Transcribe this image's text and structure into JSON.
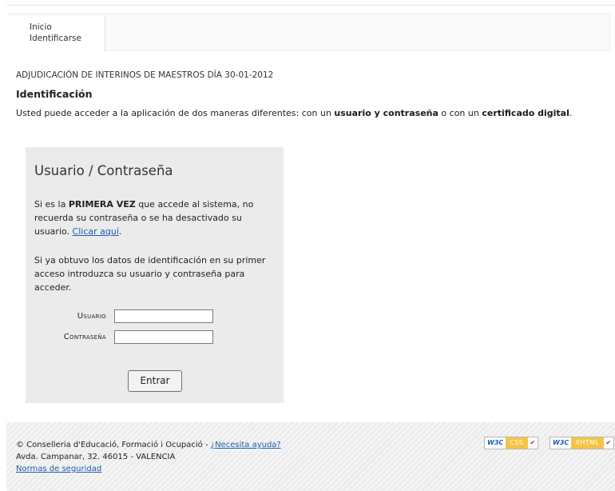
{
  "breadcrumb": {
    "items": [
      "Inicio",
      "Identificarse"
    ]
  },
  "page": {
    "subtitle": "ADJUDICACIÓN DE INTERINOS DE MAESTROS DÍA 30-01-2012",
    "heading": "Identificación",
    "intro_start": "Usted puede acceder a la aplicación de dos maneras diferentes: con un ",
    "intro_bold1": "usuario y contraseña",
    "intro_mid": " o con un ",
    "intro_bold2": "certificado digital",
    "intro_end": "."
  },
  "login": {
    "title": "Usuario / Contraseña",
    "p1_start": "Si es la ",
    "p1_bold": "PRIMERA VEZ",
    "p1_rest": " que accede al sistema, no recuerda su contraseña o se ha desactivado su usuario. ",
    "p1_link": "Clicar aquí",
    "p1_end": ".",
    "p2": "Si ya obtuvo los datos de identificación en su primer acceso introduzca su usuario y contraseña para acceder.",
    "user_label": "Usuario",
    "pass_label": "Contraseña",
    "user_value": "",
    "pass_value": "",
    "submit": "Entrar"
  },
  "footer": {
    "org": "© Conselleria d'Educació, Formació i Ocupació - ",
    "help_link": "¿Necesita ayuda?",
    "address": "Avda. Campanar, 32. 46015 - VALENCIA",
    "security_link": "Normas de seguridad",
    "badges": [
      {
        "brand": "W3C",
        "kind": "CSS",
        "icon": "check-icon"
      },
      {
        "brand": "W3C",
        "kind": "XHTML",
        "icon": "check-icon"
      }
    ],
    "badge_color": "#f6c445"
  }
}
